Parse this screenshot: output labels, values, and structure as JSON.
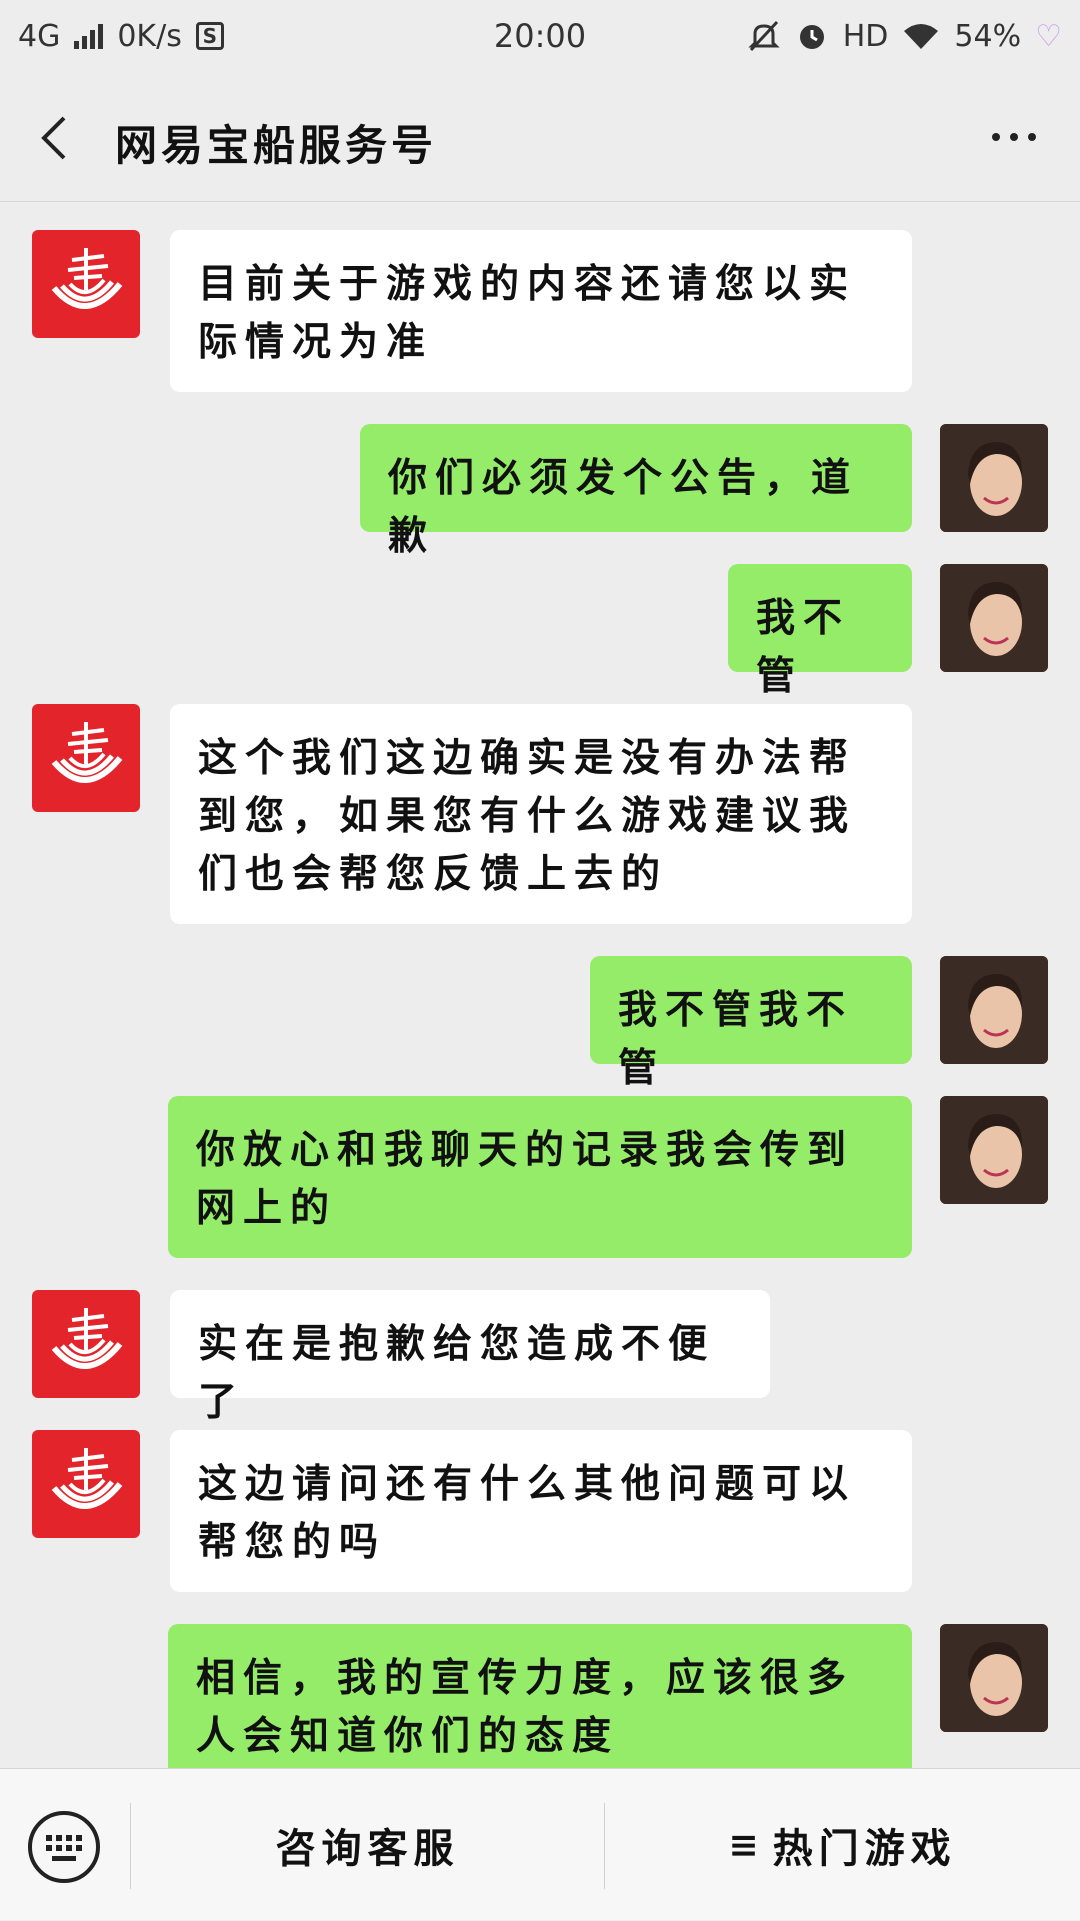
{
  "status_bar": {
    "network": "4G",
    "speed": "0K/s",
    "time": "20:00",
    "hd": "HD",
    "battery": "54%"
  },
  "header": {
    "title": "网易宝船服务号"
  },
  "messages": [
    {
      "side": "left",
      "text": "目前关于游戏的内容还请您以实际情况为准"
    },
    {
      "side": "right",
      "text": "你们必须发个公告，道歉"
    },
    {
      "side": "right",
      "text": "我不管"
    },
    {
      "side": "left",
      "text": "这个我们这边确实是没有办法帮到您，如果您有什么游戏建议我们也会帮您反馈上去的"
    },
    {
      "side": "right",
      "text": "我不管我不管"
    },
    {
      "side": "right",
      "text": "你放心和我聊天的记录我会传到网上的"
    },
    {
      "side": "left",
      "text": "实在是抱歉给您造成不便了"
    },
    {
      "side": "left",
      "text": "这边请问还有什么其他问题可以帮您的吗"
    },
    {
      "side": "right",
      "text": "相信，我的宣传力度，应该很多人会知道你们的态度"
    }
  ],
  "bottom_menu": {
    "consult_label": "咨询客服",
    "menu_glyph": "≡",
    "hot_games_label": "热门游戏"
  },
  "colors": {
    "background": "#ededed",
    "bubble_self": "#95ec69",
    "bubble_other": "#ffffff",
    "brand_red": "#e3242b"
  }
}
